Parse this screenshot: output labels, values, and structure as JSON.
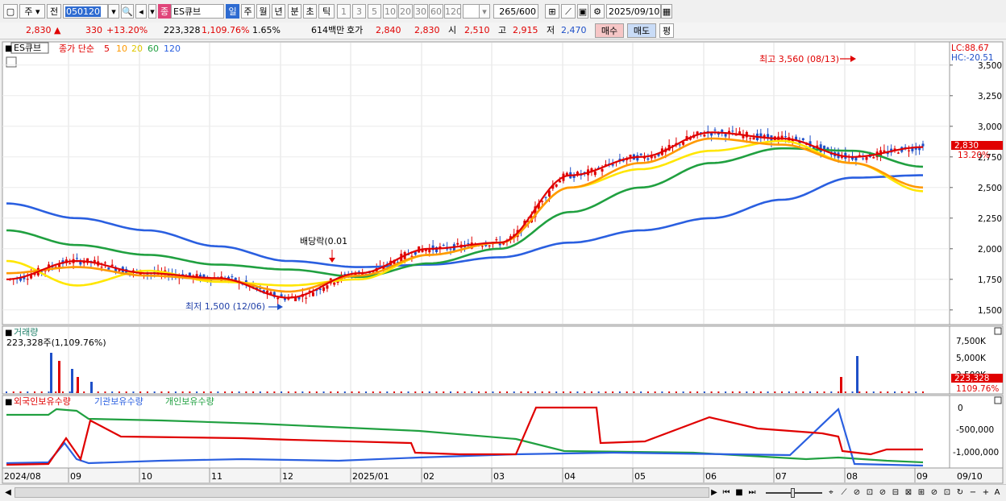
{
  "toolbar": {
    "period_tab_1": "주",
    "prev_label": "전",
    "code": "050120",
    "badge": "종",
    "name": "ES큐브",
    "periods": [
      "일",
      "주",
      "월",
      "년",
      "분",
      "초",
      "틱"
    ],
    "intervals": [
      "1",
      "3",
      "5",
      "10",
      "20",
      "30",
      "60",
      "120"
    ],
    "count": "265",
    "count_total": "/600",
    "date": "2025/09/10"
  },
  "quote": {
    "price": "2,830",
    "change_arrow": "▲",
    "change": "330",
    "change_pct": "+13.20%",
    "volume": "223,328",
    "volume_ratio": "1,109.76%",
    "turnover": "1.65%",
    "amount": "614백만",
    "bid_label": "호가",
    "ask_price": "2,840",
    "bid_price": "2,830",
    "open_label": "시",
    "open": "2,510",
    "high_label": "고",
    "high": "2,915",
    "low_label": "저",
    "low": "2,470",
    "buy_label": "매수",
    "sell_label": "매도",
    "eval_label": "평"
  },
  "price_panel": {
    "stock_tag": "ES큐브",
    "legend_main": "종가 단순",
    "ma_labels": [
      "5",
      "10",
      "20",
      "60",
      "120"
    ],
    "lc_label": "LC:88.67",
    "hc_label": "HC:-20.51",
    "high_annotation": "최고 3,560 (08/13)",
    "low_annotation": "최저 1,500 (12/06)",
    "dividend_annotation": "배당락(0.01",
    "current_price_tag": "2,830",
    "current_pct_tag": "13.20%",
    "y_ticks": [
      "3,500",
      "3,250",
      "3,000",
      "2,750",
      "2,500",
      "2,250",
      "2,000",
      "1,750",
      "1,500"
    ]
  },
  "volume_panel": {
    "title": "거래량",
    "value_line": "223,328주(1,109.76%)",
    "y_ticks": [
      "7,500K",
      "5,000K",
      "2,500K"
    ],
    "current_tag": "223,328",
    "current_pct": "1109.76%"
  },
  "holdings_panel": {
    "title_foreign": "외국인보유수량",
    "title_inst": "기관보유수량",
    "title_indiv": "개인보유수량",
    "y_ticks": [
      "0",
      "-500,000",
      "-1,000,000"
    ]
  },
  "x_axis": {
    "labels": [
      "2024/08",
      "09",
      "10",
      "11",
      "12",
      "2025/01",
      "02",
      "03",
      "04",
      "05",
      "06",
      "07",
      "08",
      "09"
    ],
    "corner_label": "09/10"
  },
  "colors": {
    "ma5": "#e00000",
    "ma10": "#ff9900",
    "ma20": "#ffe600",
    "ma60": "#20a040",
    "ma120": "#2a5fe0",
    "up": "#e00000",
    "down": "#1f50c8"
  },
  "chart_data": {
    "type": "line",
    "x": [
      "2024/08",
      "2024/09",
      "2024/10",
      "2024/11",
      "2024/12",
      "2025/01",
      "2025/02",
      "2025/03",
      "2025/04",
      "2025/05",
      "2025/06",
      "2025/07",
      "2025/08",
      "2025/09"
    ],
    "series": [
      {
        "values": [
          1750,
          1900,
          1800,
          1760,
          1600,
          1800,
          2000,
          2050,
          2600,
          2750,
          2950,
          2900,
          2750,
          2830
        ]
      },
      {
        "values": [
          1800,
          1850,
          1780,
          1750,
          1650,
          1780,
          1950,
          2050,
          2500,
          2700,
          2900,
          2850,
          2700,
          2500
        ]
      },
      {
        "values": [
          1900,
          1700,
          1820,
          1730,
          1700,
          1750,
          1950,
          2050,
          2500,
          2650,
          2800,
          2880,
          2700,
          2470
        ]
      },
      {
        "values": [
          2150,
          2030,
          1950,
          1870,
          1830,
          1770,
          1880,
          2000,
          2300,
          2500,
          2700,
          2820,
          2800,
          2670
        ]
      },
      {
        "values": [
          2370,
          2250,
          2150,
          2020,
          1900,
          1850,
          1870,
          1930,
          2050,
          2150,
          2250,
          2400,
          2580,
          2600
        ]
      }
    ],
    "ylim": [
      1400,
      3650
    ]
  }
}
